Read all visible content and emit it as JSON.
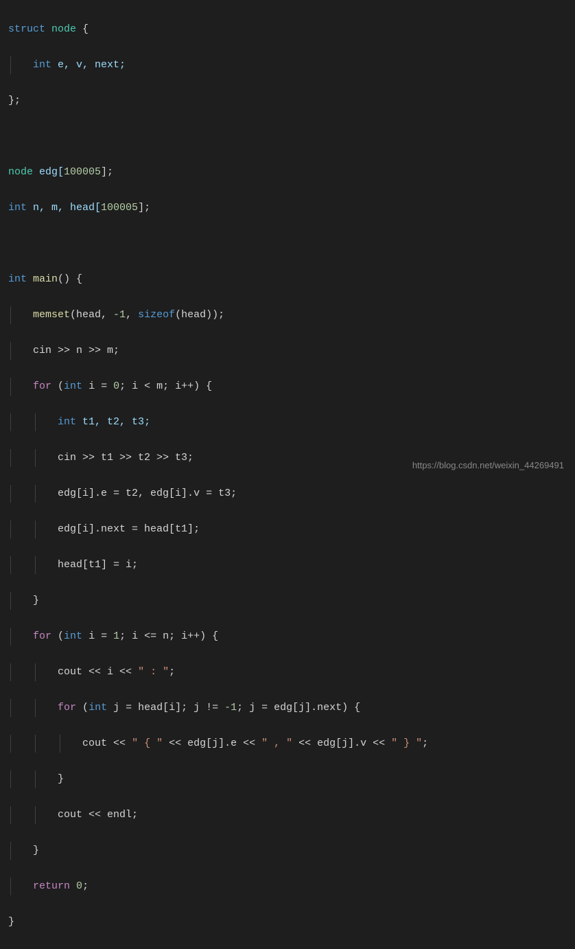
{
  "code": {
    "l1_struct": "struct",
    "l1_node": "node",
    "l1_brace": " {",
    "l2_int": "int",
    "l2_vars": " e, v, next;",
    "l3": "};",
    "l5_node": "node",
    "l5_edg": " edg[",
    "l5_num": "100005",
    "l5_end": "];",
    "l6_int": "int",
    "l6_vars": " n, m, head[",
    "l6_num": "100005",
    "l6_end": "];",
    "l8_int": "int",
    "l8_main": " main",
    "l8_end": "() {",
    "l9_memset": "memset",
    "l9_p1": "(head, ",
    "l9_neg1": "-1",
    "l9_comma": ", ",
    "l9_sizeof": "sizeof",
    "l9_end": "(head));",
    "l10": "cin >> n >> m;",
    "l11_for": "for",
    "l11_p1": " (",
    "l11_int": "int",
    "l11_p2": " i = ",
    "l11_0": "0",
    "l11_p3": "; i < m; i++) {",
    "l12_int": "int",
    "l12_vars": " t1, t2, t3;",
    "l13": "cin >> t1 >> t2 >> t3;",
    "l14": "edg[i].e = t2, edg[i].v = t3;",
    "l15": "edg[i].next = head[t1];",
    "l16": "head[t1] = i;",
    "l17": "}",
    "l18_for": "for",
    "l18_p1": " (",
    "l18_int": "int",
    "l18_p2": " i = ",
    "l18_1": "1",
    "l18_p3": "; i <= n; i++) {",
    "l19_p1": "cout << i << ",
    "l19_str": "\" : \"",
    "l19_end": ";",
    "l20_for": "for",
    "l20_p1": " (",
    "l20_int": "int",
    "l20_p2": " j = head[i]; j != ",
    "l20_neg1": "-1",
    "l20_p3": "; j = edg[j].next) {",
    "l21_p1": "cout << ",
    "l21_s1": "\" { \"",
    "l21_p2": " << edg[j].e << ",
    "l21_s2": "\" , \"",
    "l21_p3": " << edg[j].v << ",
    "l21_s3": "\" } \"",
    "l21_end": ";",
    "l22": "}",
    "l23": "cout << endl;",
    "l24": "}",
    "l25_return": "return",
    "l25_sp": " ",
    "l25_0": "0",
    "l25_end": ";",
    "l26": "}"
  },
  "watermark": "https://blog.csdn.net/weixin_44269491"
}
